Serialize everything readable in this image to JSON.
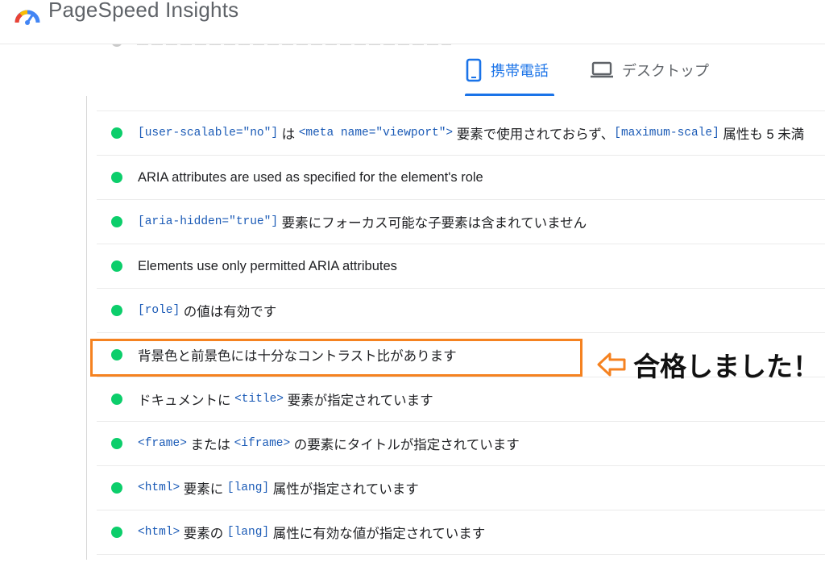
{
  "header": {
    "app_title": "PageSpeed Insights"
  },
  "tabs": [
    {
      "label": "携帯電話",
      "icon": "mobile-phone-icon",
      "active": true
    },
    {
      "label": "デスクトップ",
      "icon": "laptop-icon",
      "active": false
    }
  ],
  "colors": {
    "accent": "#1a73e8",
    "pass": "#0cce6b",
    "highlight": "#f58220",
    "code": "#1a5ab6"
  },
  "audits": [
    {
      "status": "pass",
      "segments": [
        {
          "t": "[user-scalable=\"no\"]",
          "code": true
        },
        {
          "t": " は ",
          "code": false
        },
        {
          "t": "<meta name=\"viewport\">",
          "code": true
        },
        {
          "t": " 要素で使用されておらず、",
          "code": false
        },
        {
          "t": "[maximum-scale]",
          "code": true
        },
        {
          "t": " 属性も 5 未満",
          "code": false
        }
      ]
    },
    {
      "status": "pass",
      "segments": [
        {
          "t": "ARIA attributes are used as specified for the element's role",
          "code": false
        }
      ]
    },
    {
      "status": "pass",
      "segments": [
        {
          "t": "[aria-hidden=\"true\"]",
          "code": true
        },
        {
          "t": " 要素にフォーカス可能な子要素は含まれていません",
          "code": false
        }
      ]
    },
    {
      "status": "pass",
      "segments": [
        {
          "t": "Elements use only permitted ARIA attributes",
          "code": false
        }
      ]
    },
    {
      "status": "pass",
      "segments": [
        {
          "t": "[role]",
          "code": true
        },
        {
          "t": " の値は有効です",
          "code": false
        }
      ]
    },
    {
      "status": "pass",
      "highlighted": true,
      "segments": [
        {
          "t": "背景色と前景色には十分なコントラスト比があります",
          "code": false
        }
      ]
    },
    {
      "status": "pass",
      "segments": [
        {
          "t": "ドキュメントに ",
          "code": false
        },
        {
          "t": "<title>",
          "code": true
        },
        {
          "t": " 要素が指定されています",
          "code": false
        }
      ]
    },
    {
      "status": "pass",
      "segments": [
        {
          "t": "<frame>",
          "code": true
        },
        {
          "t": " または ",
          "code": false
        },
        {
          "t": "<iframe>",
          "code": true
        },
        {
          "t": " の要素にタイトルが指定されています",
          "code": false
        }
      ]
    },
    {
      "status": "pass",
      "segments": [
        {
          "t": "<html>",
          "code": true
        },
        {
          "t": " 要素に ",
          "code": false
        },
        {
          "t": "[lang]",
          "code": true
        },
        {
          "t": " 属性が指定されています",
          "code": false
        }
      ]
    },
    {
      "status": "pass",
      "segments": [
        {
          "t": "<html>",
          "code": true
        },
        {
          "t": " 要素の ",
          "code": false
        },
        {
          "t": "[lang]",
          "code": true
        },
        {
          "t": " 属性に有効な値が指定されています",
          "code": false
        }
      ]
    }
  ],
  "annotation": {
    "text": "合格しました！",
    "arrow_icon": "left-arrow-outline-icon"
  }
}
